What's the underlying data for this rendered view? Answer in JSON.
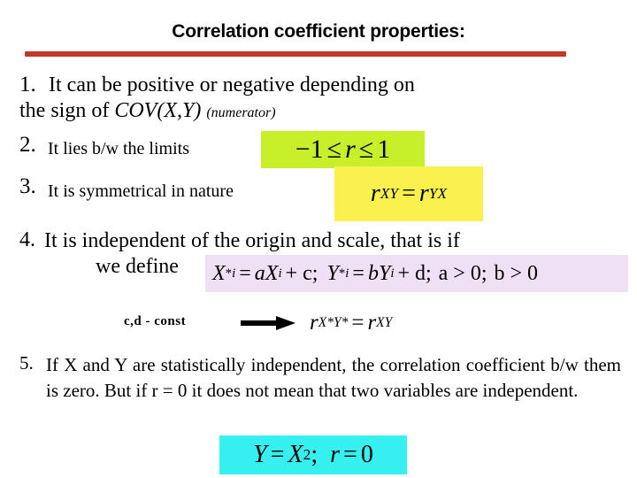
{
  "slide": {
    "title": "Correlation coefficient properties:",
    "accent_color": "#C0392B",
    "background": "#ffffff"
  },
  "items": [
    {
      "number": "1.",
      "line1": "It can be positive or negative depending on",
      "line2_prefix": "the sign of ",
      "line2_italic": "COV(X,Y)",
      "line2_note": "(numerator)"
    },
    {
      "number": "2.",
      "text": "It lies b/w the limits"
    },
    {
      "number": "3.",
      "text": "It is symmetrical in nature"
    },
    {
      "number": "4.",
      "line1": "It is independent of the origin and scale, that is if",
      "line2": "we define"
    },
    {
      "number": "5.",
      "body": "If   X     and    Y  are  statistically  independent,  the correlation coefficient b/w them is zero. But if r = 0 it does not mean that two variables are independent."
    }
  ],
  "const_note": {
    "label": "c,d  -  const",
    "arrow_icon": "right-arrow-icon"
  },
  "formulas": {
    "limits": {
      "text": "−1 ≤ r ≤ 1",
      "minus": "−",
      "one_left": "1",
      "le1": "≤",
      "r": "r",
      "le2": "≤",
      "one_right": "1",
      "highlight_color": "#C7F02A"
    },
    "symmetry": {
      "text": "rXY = rYX",
      "r1": "r",
      "sub1": "XY",
      "eq": "=",
      "r2": "r",
      "sub2": "YX",
      "highlight_color": "#FAF14E"
    },
    "transform": {
      "text": "X*i = aXi + c;  Y*i = bYi + d; a > 0; b > 0",
      "X": "X",
      "star1": "*",
      "i1": "i",
      "eq1": "=",
      "aX": "aX",
      "i2": "i",
      "plusc": "+ c;",
      "Y": "Y",
      "star2": "*",
      "i3": "i",
      "eq2": "=",
      "bY": "bY",
      "i4": "i",
      "plusd": "+ d;",
      "cond1": "a > 0;",
      "cond2": "b > 0",
      "highlight_color": "#EFE0F5"
    },
    "invariant": {
      "text": "rX*Y* = rXY",
      "r1": "r",
      "sub1": "X*Y*",
      "eq": "=",
      "r2": "r",
      "sub2": "XY"
    },
    "example": {
      "text": "Y = X2; r = 0",
      "Y": "Y",
      "eq1": "=",
      "X": "X",
      "pow": "2",
      "semi": ";",
      "r": "r",
      "eq2": "=",
      "zero": "0",
      "highlight_color": "#36F0F0"
    }
  }
}
